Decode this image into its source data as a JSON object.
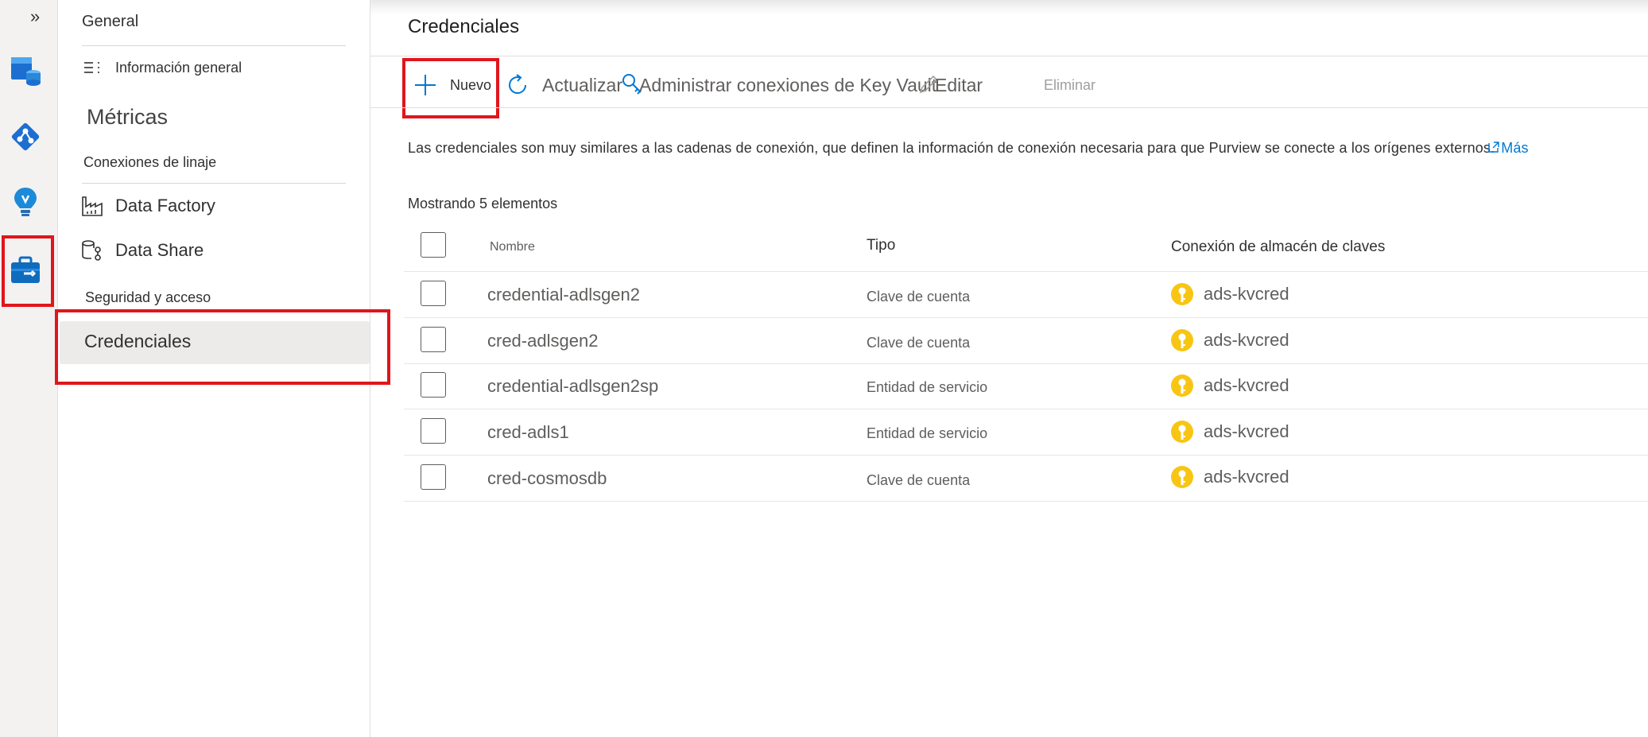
{
  "rail": {
    "expand_glyph": "»",
    "icons": [
      "data-map-icon",
      "data-catalog-icon",
      "insights-icon",
      "management-toolbox-icon"
    ]
  },
  "subnav": {
    "general_header": "General",
    "overview_label": "Información general",
    "metrics_header": "Métricas",
    "lineage_header": "Conexiones de linaje",
    "data_factory_label": "Data Factory",
    "data_share_label": "Data Share",
    "security_header": "Seguridad y acceso",
    "credentials_label": "Credenciales"
  },
  "main": {
    "title": "Credenciales",
    "toolbar": {
      "new_label": "Nuevo",
      "refresh_label": "Actualizar",
      "manage_kv_label": "Administrar conexiones de Key Vault",
      "edit_label": "Editar",
      "delete_label": "Eliminar"
    },
    "description": "Las credenciales son muy similares a las cadenas de conexión, que definen la información de conexión necesaria para que Purview se conecte a los orígenes externos.",
    "more_link": "Más",
    "showing_count": "Mostrando 5 elementos",
    "table": {
      "headers": {
        "name": "Nombre",
        "type": "Tipo",
        "kv": "Conexión de almacén de claves"
      },
      "rows": [
        {
          "name": "credential-adlsgen2",
          "type": "Clave de cuenta",
          "kv": "ads-kvcred"
        },
        {
          "name": "cred-adlsgen2",
          "type": "Clave de cuenta",
          "kv": "ads-kvcred"
        },
        {
          "name": "credential-adlsgen2sp",
          "type": "Entidad de servicio",
          "kv": "ads-kvcred"
        },
        {
          "name": "cred-adls1",
          "type": "Entidad de servicio",
          "kv": "ads-kvcred"
        },
        {
          "name": "cred-cosmosdb",
          "type": "Clave de cuenta",
          "kv": "ads-kvcred"
        }
      ]
    }
  },
  "colors": {
    "highlight": "#e0161c",
    "accent": "#0078d4",
    "keyvault": "#f8c513"
  }
}
